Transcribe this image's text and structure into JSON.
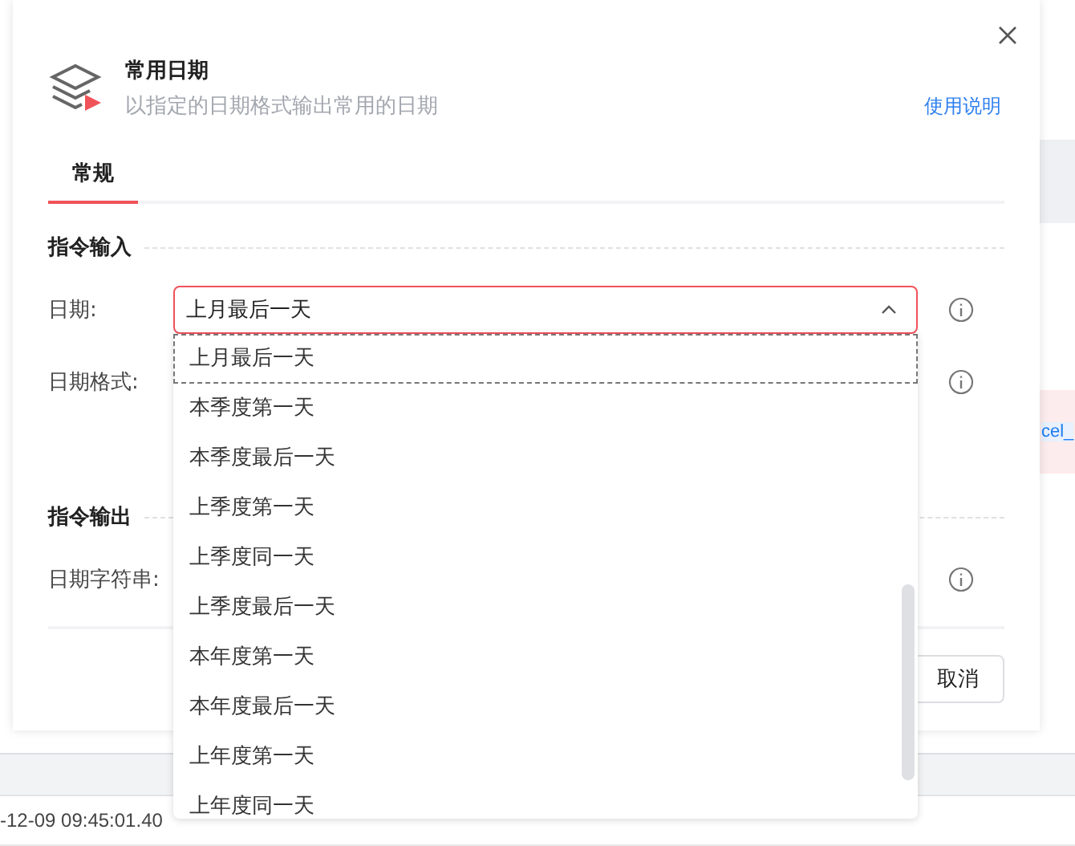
{
  "background": {
    "link": "cel_",
    "table_rows": [
      {
        "time": "-12-09 09:45:01.40"
      }
    ]
  },
  "dialog": {
    "title": "常用日期",
    "subtitle": "以指定的日期格式输出常用的日期",
    "help_link": "使用说明",
    "tabs": [
      {
        "label": "常规",
        "selected": true
      }
    ],
    "sections": [
      {
        "title": "指令输入",
        "fields": [
          {
            "label": "日期:",
            "value": "上月最后一天",
            "open": true
          },
          {
            "label": "日期格式:"
          }
        ]
      },
      {
        "title": "指令输出",
        "fields": [
          {
            "label": "日期字符串:"
          }
        ]
      }
    ],
    "buttons": [
      "取消"
    ]
  },
  "dropdown": {
    "options": [
      {
        "label": "上月最后一天",
        "selected": true
      },
      {
        "label": "本季度第一天",
        "selected": false
      },
      {
        "label": "本季度最后一天",
        "selected": false
      },
      {
        "label": "上季度第一天",
        "selected": false
      },
      {
        "label": "上季度同一天",
        "selected": false
      },
      {
        "label": "上季度最后一天",
        "selected": false
      },
      {
        "label": "本年度第一天",
        "selected": false
      },
      {
        "label": "本年度最后一天",
        "selected": false
      },
      {
        "label": "上年度第一天",
        "selected": false
      },
      {
        "label": "上年度同一天",
        "selected": false
      }
    ]
  }
}
